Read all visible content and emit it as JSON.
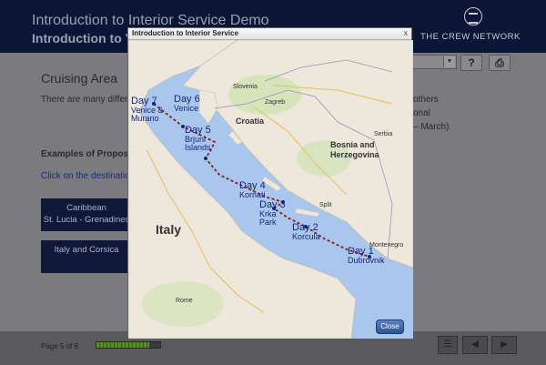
{
  "header": {
    "title": "Introduction to Interior Service Demo",
    "subtitle": "Introduction to Yachting",
    "brand": "THE CREW NETWORK"
  },
  "content": {
    "title": "Cruising Area",
    "paragraph": "There are many different cruising grounds, some well known and others off the beaten track. Focus is on the Mediterranean and the Caribbean and their seasonal weather patterns.",
    "right_lines": [
      "others",
      "onal",
      "– March)"
    ],
    "examples_label": "Examples of Proposed Itineraries",
    "link_text": "Click on the destination to view the route",
    "destinations": [
      {
        "line1": "Caribbean",
        "line2": "St. Lucia - Grenadines"
      },
      {
        "line1": "Italy and Corsica",
        "line2": ""
      }
    ],
    "toolbar": {
      "help": "?",
      "print": "⎙"
    }
  },
  "footer": {
    "page_label": "Page 5 of 6",
    "progress": 0.83,
    "menu_icon": "☰",
    "prev": "◀",
    "next": "▶"
  },
  "modal": {
    "title": "Introduction to Interior Service",
    "close_x": "x",
    "close_button": "Close",
    "itinerary": [
      {
        "day": "Day 1",
        "place": "Dubrovnik"
      },
      {
        "day": "Day 2",
        "place": "Korcula"
      },
      {
        "day": "Day 3",
        "place": "Krka Park"
      },
      {
        "day": "Day 4",
        "place": "Kornati"
      },
      {
        "day": "Day 5",
        "place": "Brjuni Islands"
      },
      {
        "day": "Day 6",
        "place": "Venice"
      },
      {
        "day": "Day 7",
        "place": "Venice & Murano"
      }
    ],
    "map_labels": {
      "italy": "Italy",
      "croatia": "Croatia",
      "bosnia": "Bosnia and Herzegovina",
      "slovenia": "Slovenia",
      "serbia": "Serbia",
      "montenegro": "Montenegro",
      "rome": "Rome",
      "split": "Split",
      "zagreb": "Zagreb"
    },
    "colors": {
      "route": "#8b1a1a",
      "sea": "#a9c7ec",
      "land": "#eee8dc",
      "label": "#17267e"
    }
  }
}
